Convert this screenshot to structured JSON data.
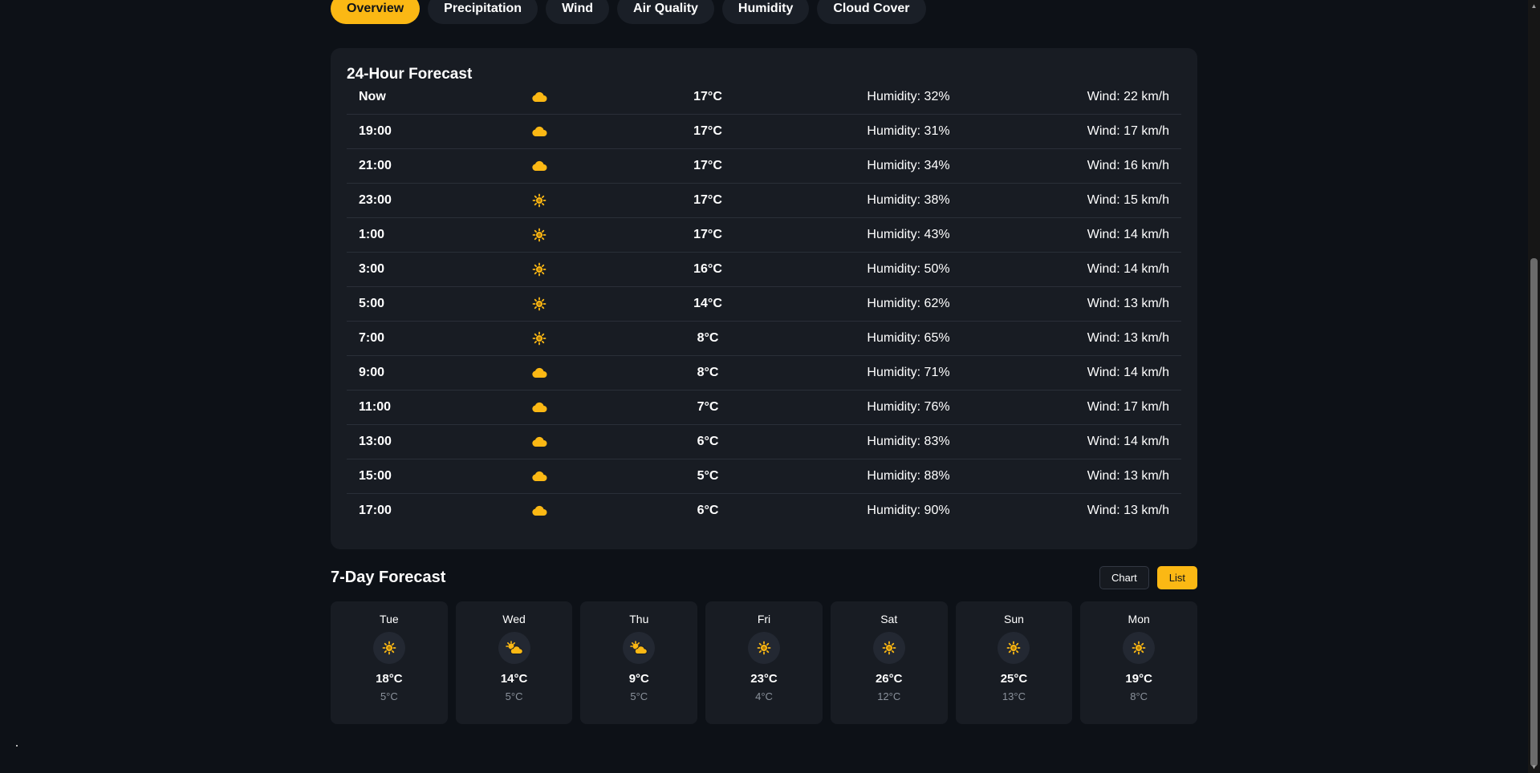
{
  "tabs": [
    {
      "label": "Overview",
      "active": true
    },
    {
      "label": "Precipitation",
      "active": false
    },
    {
      "label": "Wind",
      "active": false
    },
    {
      "label": "Air Quality",
      "active": false
    },
    {
      "label": "Humidity",
      "active": false
    },
    {
      "label": "Cloud Cover",
      "active": false
    }
  ],
  "hourly": {
    "title": "24-Hour Forecast",
    "rows": [
      {
        "time": "Now",
        "icon": "cloud-icon",
        "temp": "17°C",
        "humidity": "Humidity: 32%",
        "wind": "Wind: 22 km/h"
      },
      {
        "time": "19:00",
        "icon": "cloud-icon",
        "temp": "17°C",
        "humidity": "Humidity: 31%",
        "wind": "Wind: 17 km/h"
      },
      {
        "time": "21:00",
        "icon": "cloud-icon",
        "temp": "17°C",
        "humidity": "Humidity: 34%",
        "wind": "Wind: 16 km/h"
      },
      {
        "time": "23:00",
        "icon": "sun-icon",
        "temp": "17°C",
        "humidity": "Humidity: 38%",
        "wind": "Wind: 15 km/h"
      },
      {
        "time": "1:00",
        "icon": "sun-icon",
        "temp": "17°C",
        "humidity": "Humidity: 43%",
        "wind": "Wind: 14 km/h"
      },
      {
        "time": "3:00",
        "icon": "sun-icon",
        "temp": "16°C",
        "humidity": "Humidity: 50%",
        "wind": "Wind: 14 km/h"
      },
      {
        "time": "5:00",
        "icon": "sun-icon",
        "temp": "14°C",
        "humidity": "Humidity: 62%",
        "wind": "Wind: 13 km/h"
      },
      {
        "time": "7:00",
        "icon": "sun-icon",
        "temp": "8°C",
        "humidity": "Humidity: 65%",
        "wind": "Wind: 13 km/h"
      },
      {
        "time": "9:00",
        "icon": "cloud-icon",
        "temp": "8°C",
        "humidity": "Humidity: 71%",
        "wind": "Wind: 14 km/h"
      },
      {
        "time": "11:00",
        "icon": "cloud-icon",
        "temp": "7°C",
        "humidity": "Humidity: 76%",
        "wind": "Wind: 17 km/h"
      },
      {
        "time": "13:00",
        "icon": "cloud-icon",
        "temp": "6°C",
        "humidity": "Humidity: 83%",
        "wind": "Wind: 14 km/h"
      },
      {
        "time": "15:00",
        "icon": "cloud-icon",
        "temp": "5°C",
        "humidity": "Humidity: 88%",
        "wind": "Wind: 13 km/h"
      },
      {
        "time": "17:00",
        "icon": "cloud-icon",
        "temp": "6°C",
        "humidity": "Humidity: 90%",
        "wind": "Wind: 13 km/h"
      }
    ]
  },
  "weekly": {
    "title": "7-Day Forecast",
    "chart_label": "Chart",
    "list_label": "List",
    "active_view": "List",
    "days": [
      {
        "day": "Tue",
        "icon": "sun-icon",
        "high": "18°C",
        "low": "5°C"
      },
      {
        "day": "Wed",
        "icon": "sun-cloud-icon",
        "high": "14°C",
        "low": "5°C"
      },
      {
        "day": "Thu",
        "icon": "sun-cloud-icon",
        "high": "9°C",
        "low": "5°C"
      },
      {
        "day": "Fri",
        "icon": "sun-icon",
        "high": "23°C",
        "low": "4°C"
      },
      {
        "day": "Sat",
        "icon": "sun-icon",
        "high": "26°C",
        "low": "12°C"
      },
      {
        "day": "Sun",
        "icon": "sun-icon",
        "high": "25°C",
        "low": "13°C"
      },
      {
        "day": "Mon",
        "icon": "sun-icon",
        "high": "19°C",
        "low": "8°C"
      }
    ]
  },
  "colors": {
    "background": "#0d1117",
    "card": "#181c23",
    "accent": "#fbb814",
    "divider": "#2a2f38",
    "muted_text": "#8b929c"
  }
}
